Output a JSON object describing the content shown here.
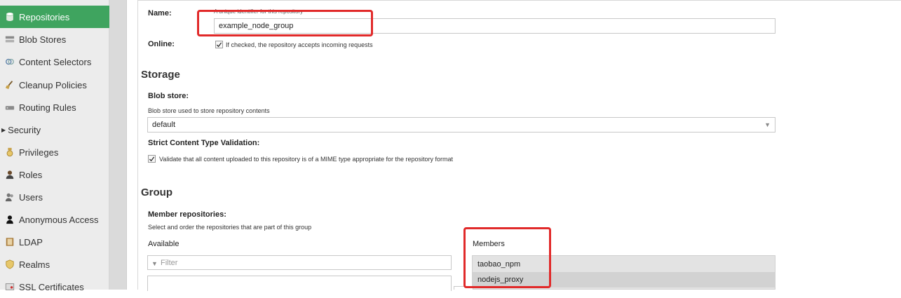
{
  "sidebar": {
    "items": [
      {
        "label": "Repositories",
        "icon": "database-icon",
        "active": true
      },
      {
        "label": "Blob Stores",
        "icon": "server-icon"
      },
      {
        "label": "Content Selectors",
        "icon": "selector-icon"
      },
      {
        "label": "Cleanup Policies",
        "icon": "broom-icon"
      },
      {
        "label": "Routing Rules",
        "icon": "router-icon"
      },
      {
        "label": "Security",
        "icon": "caret-right-icon",
        "group": true
      },
      {
        "label": "Privileges",
        "icon": "medal-icon"
      },
      {
        "label": "Roles",
        "icon": "role-icon"
      },
      {
        "label": "Users",
        "icon": "users-icon"
      },
      {
        "label": "Anonymous Access",
        "icon": "user-icon"
      },
      {
        "label": "LDAP",
        "icon": "book-icon"
      },
      {
        "label": "Realms",
        "icon": "shield-icon"
      },
      {
        "label": "SSL Certificates",
        "icon": "certificate-icon"
      }
    ]
  },
  "form": {
    "name_label": "Name:",
    "name_help": "A unique identifier for this repository",
    "name_value": "example_node_group",
    "online_label": "Online:",
    "online_help": "If checked, the repository accepts incoming requests",
    "storage_heading": "Storage",
    "blob_store_label": "Blob store:",
    "blob_store_help": "Blob store used to store repository contents",
    "blob_store_value": "default",
    "strict_label": "Strict Content Type Validation:",
    "strict_help": "Validate that all content uploaded to this repository is of a MIME type appropriate for the repository format",
    "group_heading": "Group",
    "member_label": "Member repositories:",
    "member_help": "Select and order the repositories that are part of this group",
    "available_label": "Available",
    "filter_placeholder": "Filter",
    "members_label": "Members",
    "members": [
      "taobao_npm",
      "nodejs_proxy"
    ]
  },
  "colors": {
    "accent": "#3fa45f",
    "highlight": "#e12a2a"
  }
}
